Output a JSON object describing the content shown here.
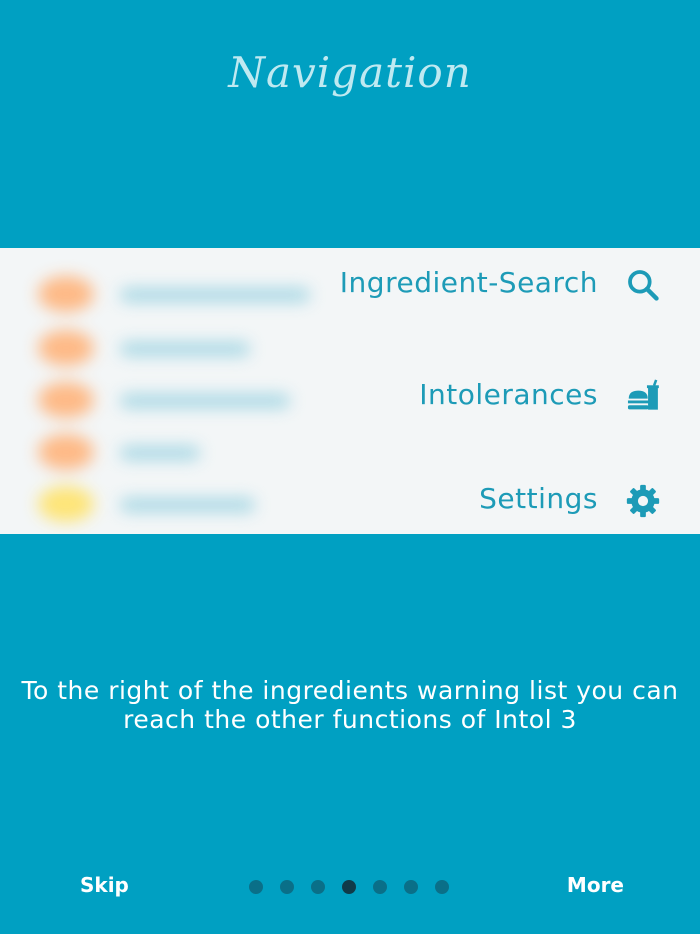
{
  "theme": {
    "background": "#00a0c2",
    "accent": "#1d9bb7",
    "title_color": "#bfe9f1",
    "dot_inactive": "#0a6f88",
    "dot_active": "#103b49"
  },
  "page": {
    "title": "Navigation",
    "description": "To the right of the ingredients warning list you can reach the other functions of Intol 3"
  },
  "menu": {
    "items": [
      {
        "label": "Ingredient-Search",
        "icon": "search-icon"
      },
      {
        "label": "Intolerances",
        "icon": "food-drink-icon"
      },
      {
        "label": "Settings",
        "icon": "gear-icon"
      }
    ]
  },
  "footer": {
    "skip_label": "Skip",
    "more_label": "More",
    "page_count": 7,
    "active_page": 4
  }
}
